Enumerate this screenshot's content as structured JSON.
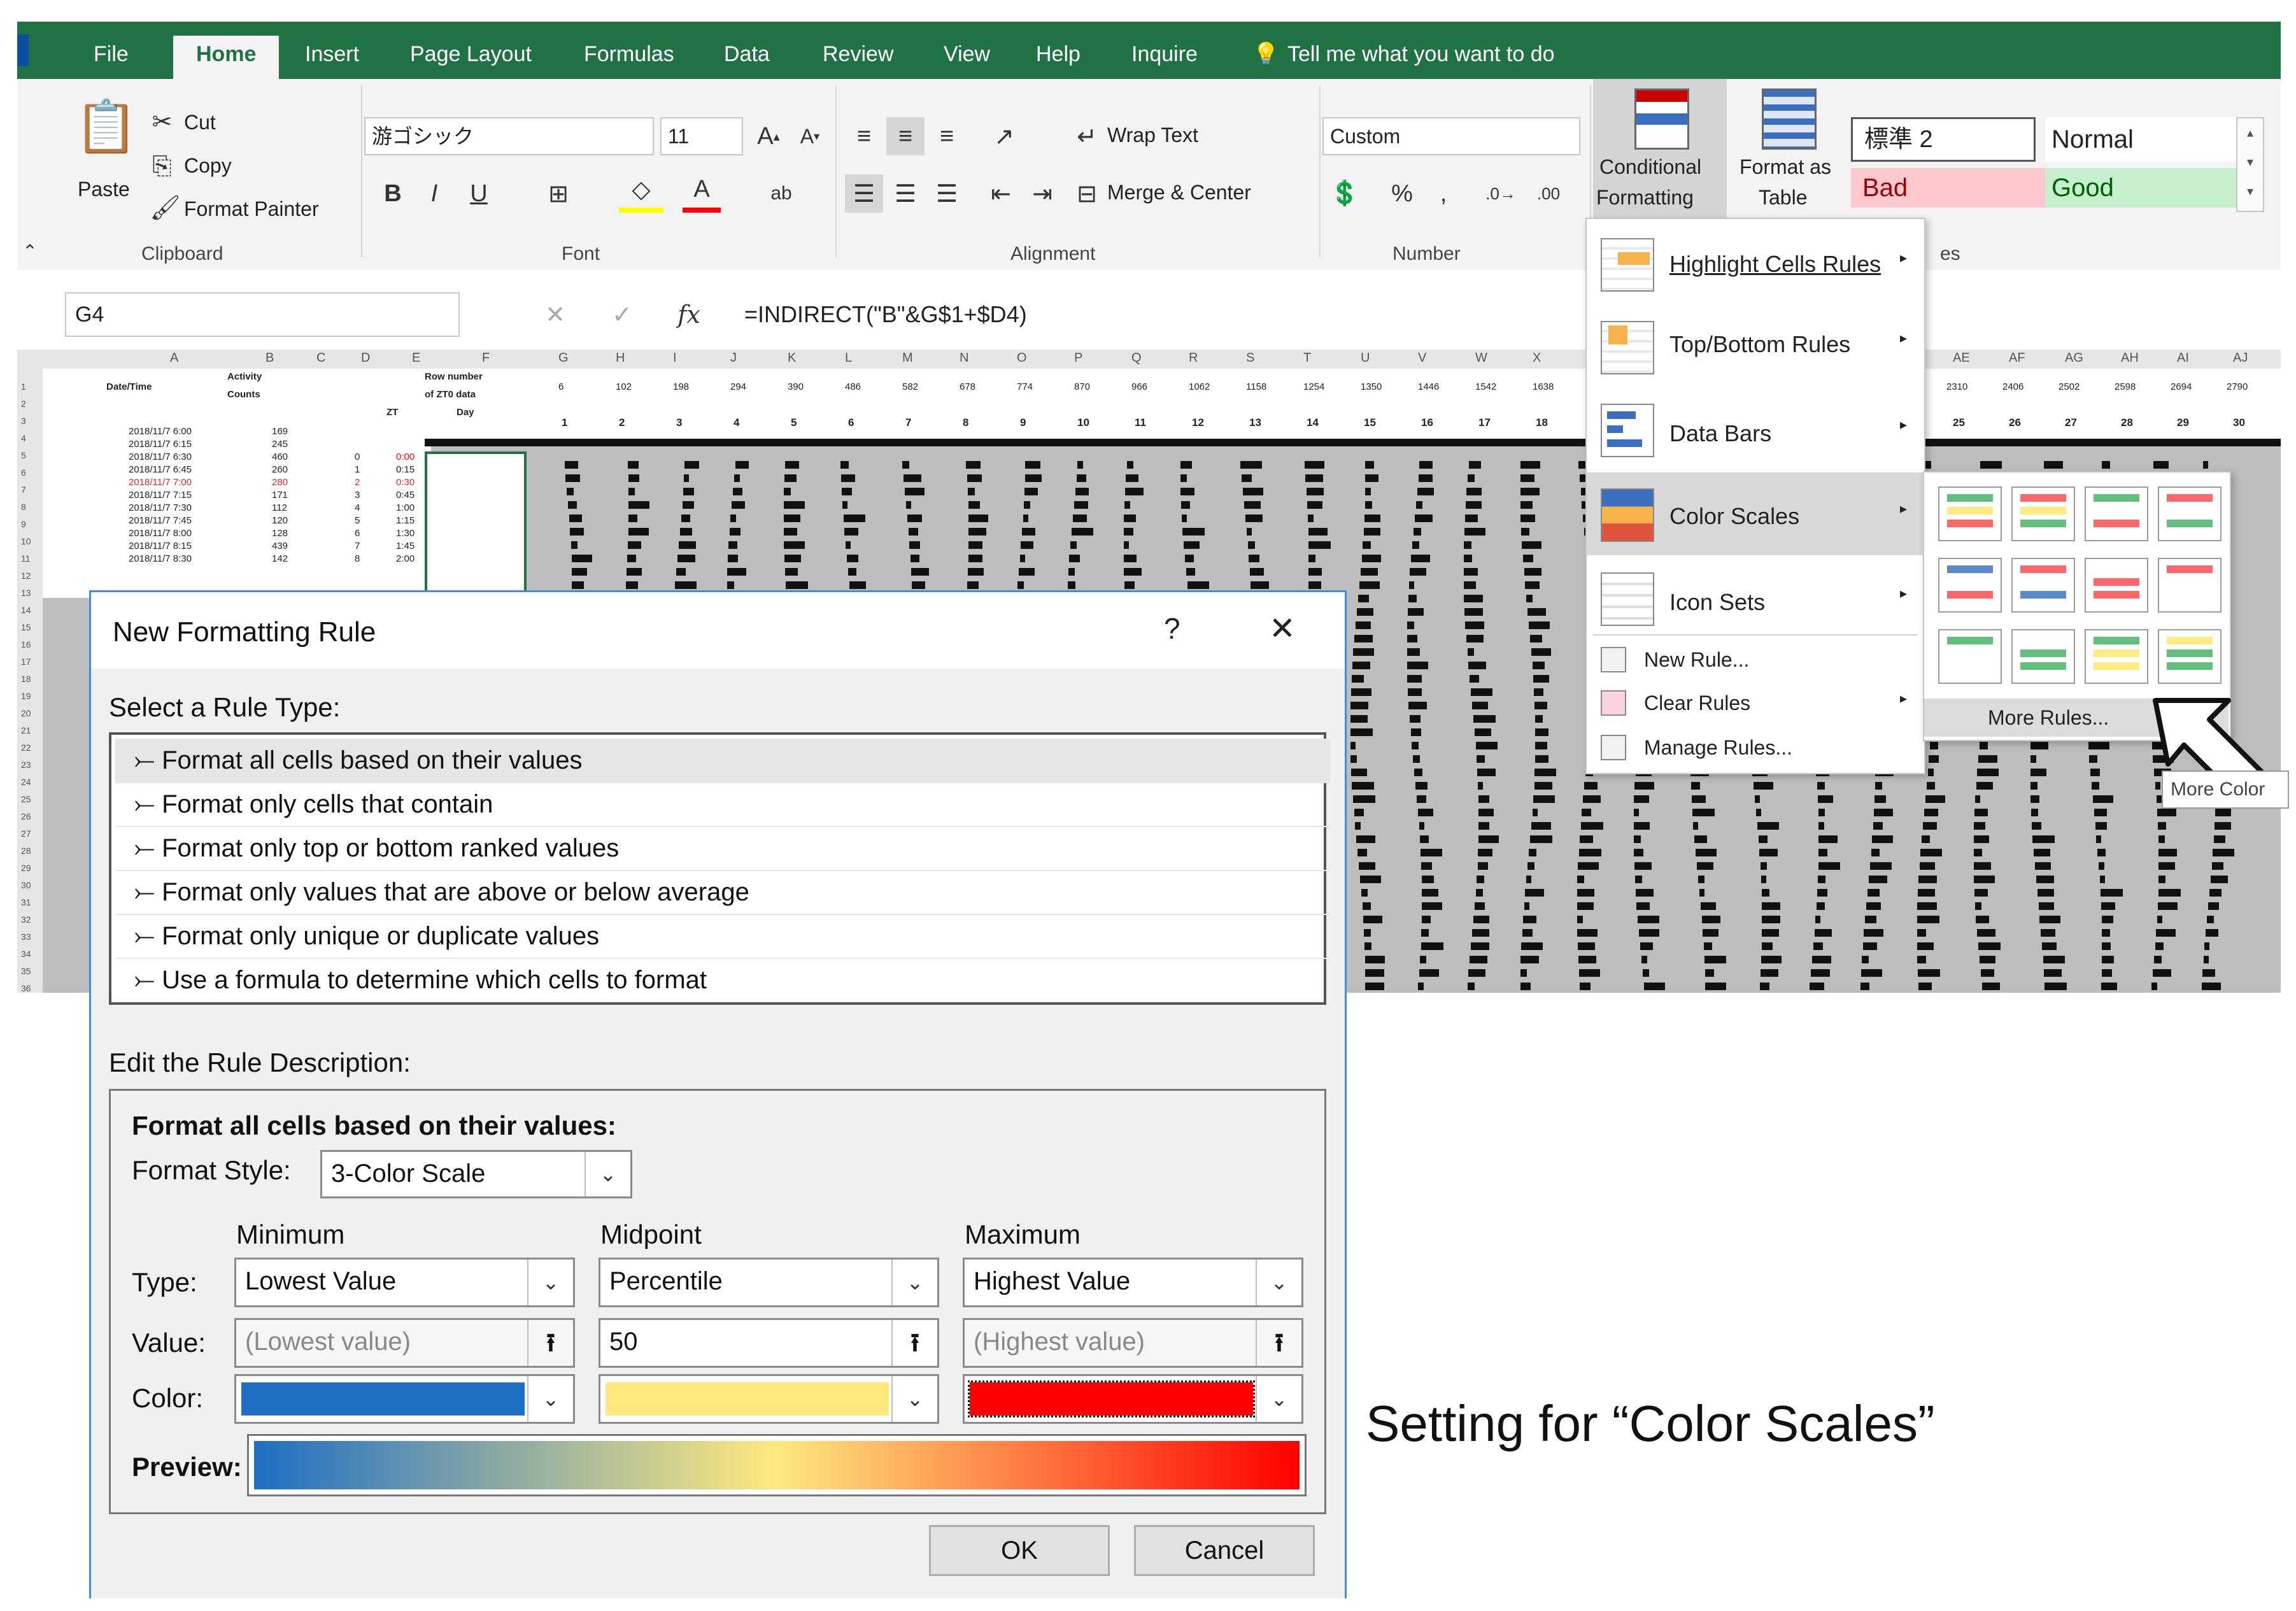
{
  "ribbon_tabs": [
    "File",
    "Home",
    "Insert",
    "Page Layout",
    "Formulas",
    "Data",
    "Review",
    "View",
    "Help",
    "Inquire"
  ],
  "tell_me": "Tell me what you want to do",
  "clipboard": {
    "paste": "Paste",
    "cut": "Cut",
    "copy": "Copy",
    "format_painter": "Format Painter",
    "group": "Clipboard"
  },
  "font": {
    "name": "游ゴシック",
    "size": "11",
    "group": "Font"
  },
  "alignment": {
    "wrap": "Wrap Text",
    "merge": "Merge & Center",
    "group": "Alignment"
  },
  "number": {
    "format": "Custom",
    "group": "Number"
  },
  "styles": {
    "cf_label1": "Conditional",
    "cf_label2": "Formatting",
    "fat_label1": "Format as",
    "fat_label2": "Table",
    "style_std": "標準 2",
    "style_normal": "Normal",
    "style_bad": "Bad",
    "style_good": "Good",
    "group_tail": "es"
  },
  "formula_bar": {
    "name_box": "G4",
    "formula": "=INDIRECT(\"B\"&G$1+$D4)"
  },
  "cf_menu": {
    "items": [
      "Highlight Cells Rules",
      "Top/Bottom Rules",
      "Data Bars",
      "Color Scales",
      "Icon Sets"
    ],
    "new_rule": "New Rule...",
    "clear_rules": "Clear Rules",
    "manage_rules": "Manage Rules...",
    "more_rules": "More Rules...",
    "tooltip": "More Color"
  },
  "sheet_top": {
    "col_letters": [
      "A",
      "B",
      "C",
      "D",
      "E",
      "F",
      "G",
      "H",
      "I",
      "J",
      "K",
      "L",
      "M",
      "N",
      "O",
      "P",
      "Q",
      "R",
      "S",
      "T",
      "U",
      "V",
      "W",
      "X"
    ],
    "right_letters": [
      "AE",
      "AF",
      "AG",
      "AH",
      "AI",
      "AJ"
    ],
    "hdr_datetime": "Date/Time",
    "hdr_activity": "Activity",
    "hdr_counts": "Counts",
    "hdr_rownum": "Row number",
    "hdr_zt0": "of ZT0 data",
    "hdr_day": "Day",
    "hdr_zt": "ZT",
    "row1_values": [
      "6",
      "102",
      "198",
      "294",
      "390",
      "486",
      "582",
      "678",
      "774",
      "870",
      "966",
      "1062",
      "1158",
      "1254",
      "1350",
      "1446",
      "1542",
      "1638"
    ],
    "row1_right": [
      "2310",
      "2406",
      "2502",
      "2598",
      "2694",
      "2790"
    ],
    "day_numbers": [
      "1",
      "2",
      "3",
      "4",
      "5",
      "6",
      "7",
      "8",
      "9",
      "10",
      "11",
      "12",
      "13",
      "14",
      "15",
      "16",
      "17",
      "18"
    ],
    "day_right": [
      "25",
      "26",
      "27",
      "28",
      "29",
      "30"
    ],
    "rows": [
      [
        "2018/11/7 6:00",
        "169",
        "",
        ""
      ],
      [
        "2018/11/7 6:15",
        "245",
        "",
        ""
      ],
      [
        "2018/11/7 6:30",
        "460",
        "0",
        "0:00"
      ],
      [
        "2018/11/7 6:45",
        "260",
        "1",
        "0:15"
      ],
      [
        "2018/11/7 7:00",
        "280",
        "2",
        "0:30"
      ],
      [
        "2018/11/7 7:15",
        "171",
        "3",
        "0:45"
      ],
      [
        "2018/11/7 7:30",
        "112",
        "4",
        "1:00"
      ],
      [
        "2018/11/7 7:45",
        "120",
        "5",
        "1:15"
      ],
      [
        "2018/11/7 8:00",
        "128",
        "6",
        "1:30"
      ],
      [
        "2018/11/7 8:15",
        "439",
        "7",
        "1:45"
      ],
      [
        "2018/11/7 8:30",
        "142",
        "8",
        "2:00"
      ]
    ]
  },
  "dialog": {
    "title": "New Formatting Rule",
    "help": "?",
    "close": "✕",
    "select_label": "Select a Rule Type:",
    "rule_types": [
      "Format all cells based on their values",
      "Format only cells that contain",
      "Format only top or bottom ranked values",
      "Format only values that are above or below average",
      "Format only unique or duplicate values",
      "Use a formula to determine which cells to format"
    ],
    "edit_label": "Edit the Rule Description:",
    "desc_title": "Format all cells based on their values:",
    "format_style_label": "Format Style:",
    "format_style": "3-Color Scale",
    "col_min": "Minimum",
    "col_mid": "Midpoint",
    "col_max": "Maximum",
    "type_label": "Type:",
    "value_label": "Value:",
    "color_label": "Color:",
    "preview_label": "Preview:",
    "min_type": "Lowest Value",
    "mid_type": "Percentile",
    "max_type": "Highest Value",
    "min_value": "(Lowest value)",
    "mid_value": "50",
    "max_value": "(Highest value)",
    "min_color": "#1f6fc5",
    "mid_color": "#ffe97f",
    "max_color": "#ff0000",
    "ok": "OK",
    "cancel": "Cancel"
  },
  "caption": "Setting for “Color Scales”"
}
